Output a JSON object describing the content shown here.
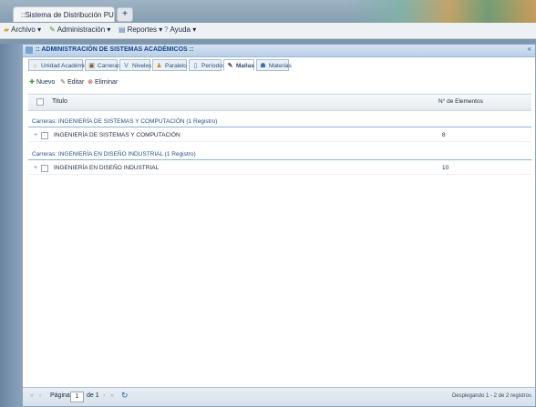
{
  "browser": {
    "tab_title": "::Sistema de Distribución PUCESA::",
    "new_tab": "+"
  },
  "menubar": {
    "items": [
      {
        "label": "Archivo",
        "icon": "folder-icon"
      },
      {
        "label": "Administración",
        "icon": "wrench-icon"
      },
      {
        "label": "Reportes",
        "icon": "report-icon"
      },
      {
        "label": "Ayuda",
        "icon": "help-icon"
      }
    ]
  },
  "window": {
    "title": ":: ADMINISTRACIÓN DE SISTEMAS ACADÉMICOS ::",
    "collapse": "«"
  },
  "nav_tabs": [
    {
      "label": "Unidad Académica",
      "icon": "building-icon"
    },
    {
      "label": "Carreras",
      "icon": "career-icon"
    },
    {
      "label": "Niveles",
      "icon": "levels-icon"
    },
    {
      "label": "Paralelo",
      "icon": "group-icon"
    },
    {
      "label": "Períodos",
      "icon": "calendar-icon"
    },
    {
      "label": "Mallas",
      "icon": "pencil-icon"
    },
    {
      "label": "Materias",
      "icon": "book-icon"
    }
  ],
  "toolbar": {
    "new_label": "Nuevo",
    "edit_label": "Editar",
    "delete_label": "Eliminar"
  },
  "grid": {
    "col_name": "Titulo",
    "col_count": "N° de Elementos",
    "groups": [
      {
        "header": "Carreras: INGENIERÍA DE SISTEMAS Y COMPUTACIÓN (1 Registro)",
        "rows": [
          {
            "name": "INGENIERÍA DE SISTEMAS Y COMPUTACIÓN",
            "count": "8"
          }
        ]
      },
      {
        "header": "Carreras: INGENIERÍA EN DISEÑO INDUSTRIAL (1 Registro)",
        "rows": [
          {
            "name": "INGENIERÍA EN DISEÑO INDUSTRIAL",
            "count": "10"
          }
        ]
      }
    ]
  },
  "paging": {
    "page_label": "Página",
    "page_value": "1",
    "of_label": "de 1",
    "info": "Desplegando 1 - 2 de 2 registros"
  }
}
